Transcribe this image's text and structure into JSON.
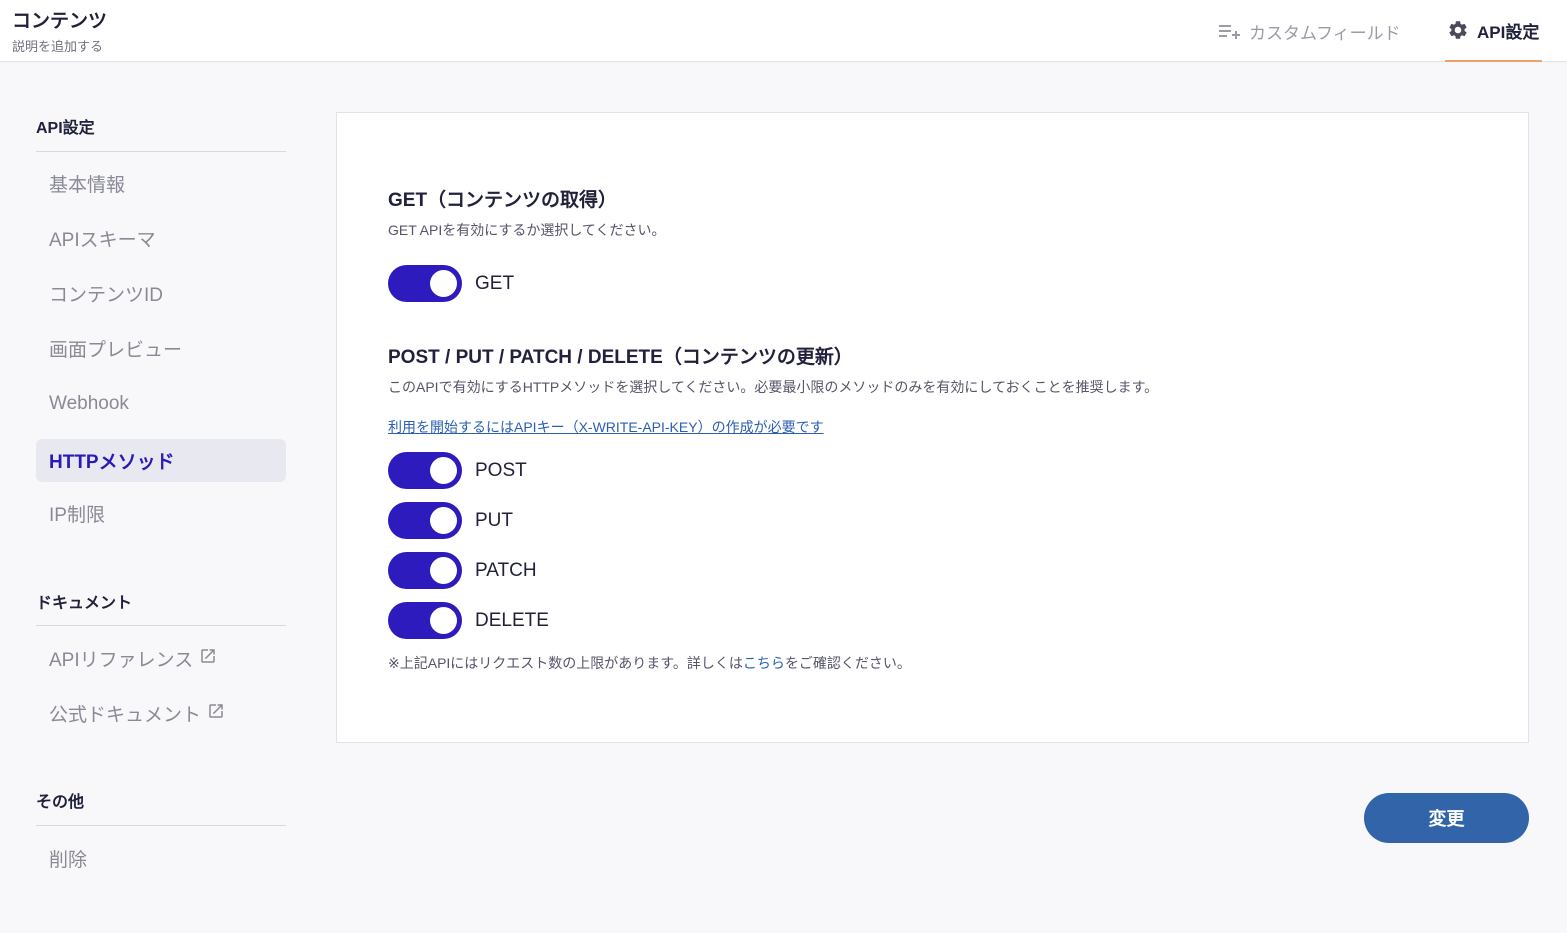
{
  "header": {
    "title": "コンテンツ",
    "subtitle": "説明を追加する",
    "tabs": [
      {
        "label": "カスタムフィールド",
        "icon": "playlist-add-icon",
        "active": false
      },
      {
        "label": "API設定",
        "icon": "gear-icon",
        "active": true
      }
    ]
  },
  "sidebar": {
    "sections": [
      {
        "title": "API設定",
        "items": [
          {
            "label": "基本情報",
            "active": false
          },
          {
            "label": "APIスキーマ",
            "active": false
          },
          {
            "label": "コンテンツID",
            "active": false
          },
          {
            "label": "画面プレビュー",
            "active": false
          },
          {
            "label": "Webhook",
            "active": false
          },
          {
            "label": "HTTPメソッド",
            "active": true
          },
          {
            "label": "IP制限",
            "active": false
          }
        ]
      },
      {
        "title": "ドキュメント",
        "items": [
          {
            "label": "APIリファレンス",
            "external": true
          },
          {
            "label": "公式ドキュメント",
            "external": true
          }
        ]
      },
      {
        "title": "その他",
        "items": [
          {
            "label": "削除"
          }
        ]
      }
    ]
  },
  "get_section": {
    "title": "GET（コンテンツの取得）",
    "description": "GET APIを有効にするか選択してください。",
    "toggles": [
      {
        "label": "GET",
        "on": true
      }
    ]
  },
  "write_section": {
    "title": "POST / PUT / PATCH / DELETE（コンテンツの更新）",
    "description": "このAPIで有効にするHTTPメソッドを選択してください。必要最小限のメソッドのみを有効にしておくことを推奨します。",
    "link": "利用を開始するにはAPIキー（X-WRITE-API-KEY）の作成が必要です",
    "toggles": [
      {
        "label": "POST",
        "on": true
      },
      {
        "label": "PUT",
        "on": true
      },
      {
        "label": "PATCH",
        "on": true
      },
      {
        "label": "DELETE",
        "on": true
      }
    ]
  },
  "note": {
    "prefix": "※上記APIにはリクエスト数の上限があります。詳しくは",
    "link": "こちら",
    "suffix": "をご確認ください。"
  },
  "submit_label": "変更",
  "colors": {
    "accent": "#2e1bbd",
    "button": "#3164a8",
    "tab_underline": "#f0a06a",
    "link": "#2b5fb3"
  }
}
